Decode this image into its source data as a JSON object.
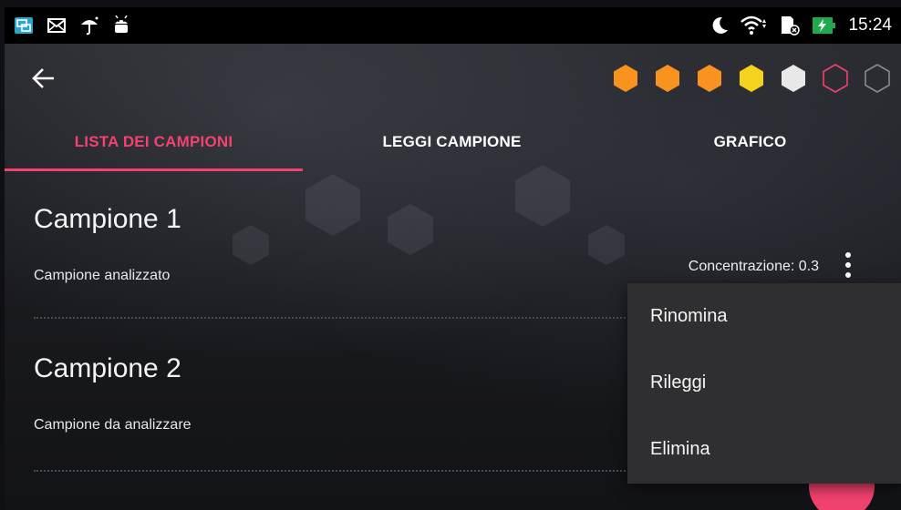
{
  "status_bar": {
    "time": "15:24",
    "icons_left": [
      "screen-mirror-icon",
      "mail-icon",
      "umbrella-icon",
      "android-icon"
    ],
    "icons_right": [
      "moon-icon",
      "wifi-icon",
      "sd-card-icon",
      "battery-charging-icon"
    ]
  },
  "app_bar": {
    "back_icon": "arrow-left-icon",
    "progress_hexagons": [
      {
        "state": "filled",
        "color": "#f7931e"
      },
      {
        "state": "filled",
        "color": "#f7931e"
      },
      {
        "state": "filled",
        "color": "#f7931e"
      },
      {
        "state": "filled",
        "color": "#f5d31c"
      },
      {
        "state": "filled",
        "color": "#e8e8e8"
      },
      {
        "state": "outline",
        "color": "#f2426f"
      },
      {
        "state": "outline",
        "color": "#8a8a8a"
      }
    ]
  },
  "tabs": [
    {
      "label": "LISTA DEI CAMPIONI",
      "active": true
    },
    {
      "label": "LEGGI CAMPIONE",
      "active": false
    },
    {
      "label": "GRAFICO",
      "active": false
    }
  ],
  "samples": [
    {
      "title": "Campione 1",
      "status": "Campione analizzato",
      "concentration": "Concentrazione: 0.3"
    },
    {
      "title": "Campione 2",
      "status": "Campione da analizzare"
    }
  ],
  "context_menu": {
    "items": [
      "Rinomina",
      "Rileggi",
      "Elimina"
    ]
  },
  "colors": {
    "accent": "#f2426f",
    "background": "#1b1c20",
    "menu_background": "#2f2f31"
  }
}
